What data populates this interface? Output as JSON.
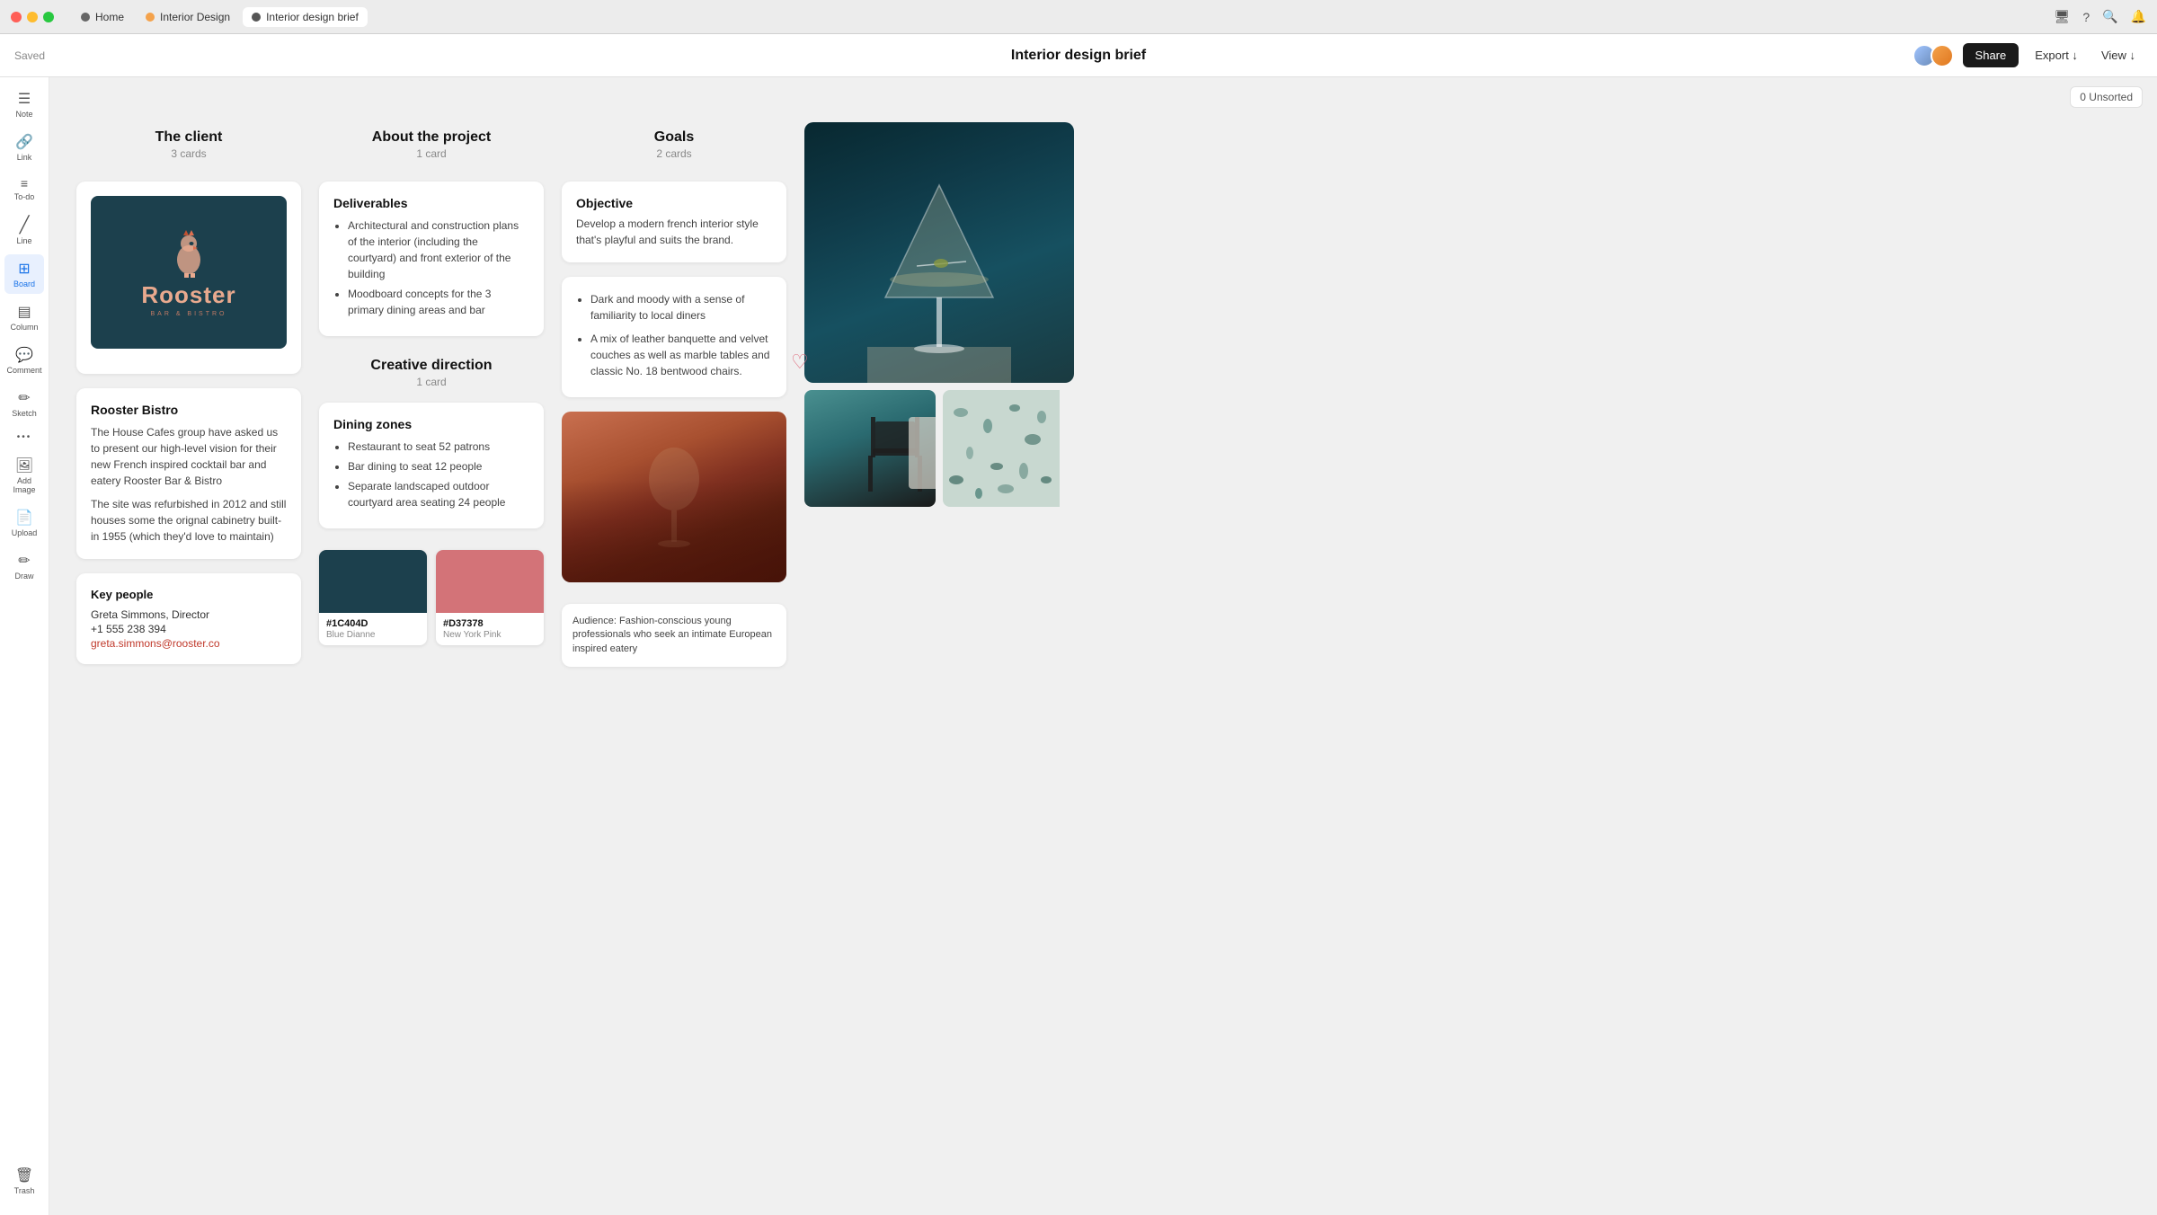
{
  "titlebar": {
    "tabs": [
      {
        "id": "home",
        "label": "Home",
        "dot_color": "#666",
        "active": false
      },
      {
        "id": "interior-design",
        "label": "Interior Design",
        "dot_color": "#f4a24b",
        "active": false
      },
      {
        "id": "brief",
        "label": "Interior design brief",
        "dot_color": "#555",
        "active": true
      }
    ]
  },
  "toolbar": {
    "saved_label": "Saved",
    "title": "Interior design brief",
    "share_label": "Share",
    "export_label": "Export ↓",
    "view_label": "View ↓",
    "unsorted_label": "0 Unsorted"
  },
  "sidebar": {
    "items": [
      {
        "id": "note",
        "icon": "☰",
        "label": "Note"
      },
      {
        "id": "link",
        "icon": "🔗",
        "label": "Link"
      },
      {
        "id": "todo",
        "icon": "≡",
        "label": "To-do"
      },
      {
        "id": "line",
        "icon": "╱",
        "label": "Line"
      },
      {
        "id": "board",
        "icon": "⊞",
        "label": "Board",
        "active": true
      },
      {
        "id": "column",
        "icon": "▤",
        "label": "Column"
      },
      {
        "id": "comment",
        "icon": "💬",
        "label": "Comment"
      },
      {
        "id": "sketch",
        "icon": "✏",
        "label": "Sketch"
      },
      {
        "id": "more",
        "icon": "•••",
        "label": ""
      },
      {
        "id": "add-image",
        "icon": "🖼",
        "label": "Add Image"
      },
      {
        "id": "upload",
        "icon": "📄",
        "label": "Upload"
      },
      {
        "id": "draw",
        "icon": "✏",
        "label": "Draw"
      }
    ],
    "trash_label": "Trash"
  },
  "columns": [
    {
      "id": "client",
      "title": "The client",
      "count": "3 cards",
      "cards": [
        {
          "type": "logo",
          "logo_title": "Rooster",
          "logo_subtitle": "BAR & BISTRO"
        },
        {
          "type": "text",
          "title": "Rooster Bistro",
          "paragraphs": [
            "The House Cafes group have asked us to present our high-level vision for their new French inspired cocktail bar and eatery Rooster Bar & Bistro",
            "The site was refurbished in 2012 and still houses some the orignal cabinetry built-in 1955 (which they'd love to maintain)"
          ]
        },
        {
          "type": "key-people",
          "section_title": "Key people",
          "name": "Greta Simmons, Director",
          "phone": "+1 555 238 394",
          "email": "greta.simmons@rooster.co"
        }
      ]
    },
    {
      "id": "about",
      "title": "About the project",
      "count": "1 card",
      "cards": [
        {
          "type": "deliverables",
          "title": "Deliverables",
          "items": [
            "Architectural and construction plans of the interior (including the courtyard) and front exterior of the building",
            "Moodboard concepts for the 3 primary dining areas and bar"
          ]
        }
      ]
    },
    {
      "id": "creative",
      "title": "Creative direction",
      "count": "1 card",
      "cards": [
        {
          "type": "dining",
          "title": "Dining zones",
          "items": [
            "Restaurant to seat 52 patrons",
            "Bar dining to seat 12 people",
            "Separate landscaped outdoor courtyard area seating 24 people"
          ],
          "swatches": [
            {
              "hex": "#1C404D",
              "name": "Blue Dianne",
              "label": "#1C404D"
            },
            {
              "hex": "#D37378",
              "name": "New York Pink",
              "label": "#D37378"
            }
          ]
        }
      ]
    },
    {
      "id": "goals",
      "title": "Goals",
      "count": "2 cards",
      "cards": [
        {
          "type": "objective",
          "title": "Objective",
          "text": "Develop a modern french interior style that's playful and suits the brand."
        },
        {
          "type": "goals-list",
          "items": [
            "Dark and moody with a sense of familiarity to local diners",
            "A mix of leather banquette and velvet couches as well as marble tables and classic No. 18 bentwood chairs."
          ]
        }
      ]
    }
  ],
  "moodboard": {
    "audience_text": "Audience: Fashion-conscious young professionals who seek an intimate European inspired eatery"
  }
}
